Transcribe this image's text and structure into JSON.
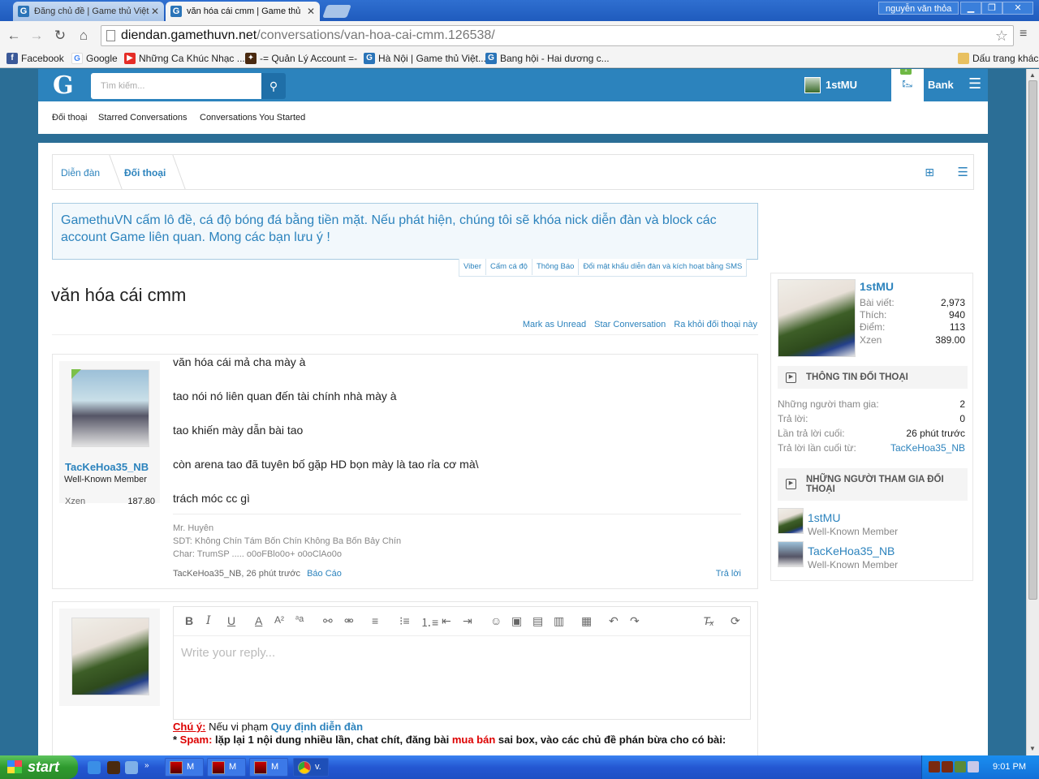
{
  "browser": {
    "tabs": [
      {
        "title": "Đăng chủ đề | Game thủ Việt"
      },
      {
        "title": "văn hóa cái cmm | Game thủ"
      }
    ],
    "window_user": "nguyễn văn thỏa",
    "url_host": "diendan.gamethuvn.net",
    "url_path": "/conversations/van-hoa-cai-cmm.126538/",
    "bookmarks": [
      "Facebook",
      "Google",
      "Những Ca Khúc Nhạc ...",
      "-= Quản Lý Account =-",
      "Hà Nội | Game thủ Việt...",
      "Bang hội - Hai dương c..."
    ],
    "other_bookmarks": "Dấu trang khác"
  },
  "header": {
    "logo": "G",
    "search_placeholder": "Tìm kiếm...",
    "username": "1stMU",
    "flag_badge": "1",
    "bank": "Bank"
  },
  "subnav": [
    "Đối thoại",
    "Starred Conversations",
    "Conversations You Started"
  ],
  "breadcrumb": [
    "Diễn đàn",
    "Đối thoại"
  ],
  "notice": {
    "text": "GamethuVN cấm lô đề, cá độ bóng đá bằng tiền mặt. Nếu phát hiện, chúng tôi sẽ khóa nick diễn đàn và block các account Game liên quan. Mong các bạn lưu ý !",
    "links": [
      "Viber",
      "Cấm cá độ",
      "Thông Báo",
      "Đổi mật khẩu diễn đàn và kích hoạt bằng SMS"
    ]
  },
  "conversation": {
    "title": "văn hóa cái cmm",
    "actions": [
      "Mark as Unread",
      "Star Conversation",
      "Ra khỏi đối thoại này"
    ]
  },
  "message": {
    "author": "TacKeHoa35_NB",
    "author_title": "Well-Known Member",
    "xzen_label": "Xzen",
    "xzen_value": "187.80",
    "lines": [
      "văn hóa cái mả cha mày à",
      "tao nói nó liên quan đến tài chính nhà mày à",
      "tao khiến mày dẫn bài tao",
      "còn arena tao đã tuyên bố gặp HD bọn mày là tao rỉa cơ mà\\",
      "trách móc cc gì"
    ],
    "signature": [
      "Mr. Huyên",
      "SDT: Không Chín Tám Bốn Chín Không Ba Bốn Bảy Chín",
      "Char: TrumSP ..... o0oFBlo0o+ o0oClAo0o"
    ],
    "meta": "TacKeHoa35_NB, 26 phút trước",
    "report": "Báo Cáo",
    "reply": "Trả lời"
  },
  "reply_editor": {
    "placeholder": "Write your reply...",
    "rules_label": "Chú ý:",
    "rules_text": " Nếu vi phạm ",
    "rules_link": "Quy định diễn đàn",
    "spam_prefix": "* ",
    "spam_label": "Spam:",
    "spam_text1": " lặp lại 1 nội dung nhiều lần, chat chít, đăng bài ",
    "spam_red": "mua bán",
    "spam_text2": " sai box, vào các chủ đề phán bừa cho có bài:"
  },
  "sidebar": {
    "profile": {
      "name": "1stMU",
      "stats": [
        {
          "label": "Bài viết:",
          "value": "2,973"
        },
        {
          "label": "Thích:",
          "value": "940"
        },
        {
          "label": "Điểm:",
          "value": "113"
        },
        {
          "label": "Xzen",
          "value": "389.00"
        }
      ]
    },
    "info_heading": "THÔNG TIN ĐỐI THOẠI",
    "info": [
      {
        "label": "Những người tham gia:",
        "value": "2"
      },
      {
        "label": "Trả lời:",
        "value": "0"
      },
      {
        "label": "Lần trả lời cuối:",
        "value": "26 phút trước"
      },
      {
        "label": "Trả lời lần cuối từ:",
        "value": "TacKeHoa35_NB"
      }
    ],
    "participants_heading": "NHỮNG NGƯỜI THAM GIA ĐỐI THOẠI",
    "participants": [
      {
        "name": "1stMU",
        "title": "Well-Known Member"
      },
      {
        "name": "TacKeHoa35_NB",
        "title": "Well-Known Member"
      }
    ]
  },
  "taskbar": {
    "start": "start",
    "tasks": [
      "M",
      "M",
      "M",
      "v."
    ],
    "clock": "9:01 PM"
  }
}
